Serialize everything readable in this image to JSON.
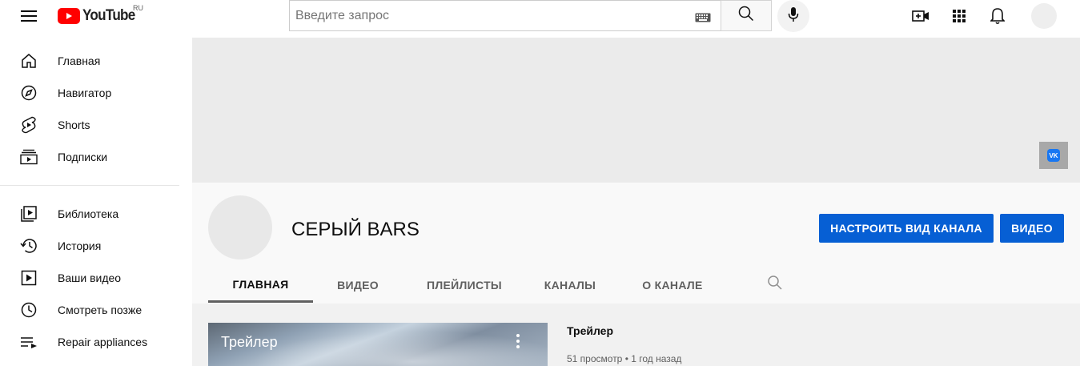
{
  "header": {
    "logo_text": "YouTube",
    "region": "RU",
    "search_placeholder": "Введите запрос"
  },
  "sidebar": {
    "items": [
      {
        "label": "Главная",
        "icon": "home-icon"
      },
      {
        "label": "Навигатор",
        "icon": "compass-icon"
      },
      {
        "label": "Shorts",
        "icon": "shorts-icon"
      },
      {
        "label": "Подписки",
        "icon": "subscriptions-icon"
      },
      {
        "label": "Библиотека",
        "icon": "library-icon"
      },
      {
        "label": "История",
        "icon": "history-icon"
      },
      {
        "label": "Ваши видео",
        "icon": "your-videos-icon"
      },
      {
        "label": "Смотреть позже",
        "icon": "watch-later-icon"
      },
      {
        "label": "Repair appliances",
        "icon": "playlist-icon"
      }
    ]
  },
  "channel": {
    "name": "СЕРЫЙ BARS",
    "customize_button": "НАСТРОИТЬ ВИД КАНАЛА",
    "video_button": "ВИДЕО",
    "vk_label": "VK"
  },
  "tabs": [
    {
      "label": "ГЛАВНАЯ",
      "active": true
    },
    {
      "label": "ВИДЕО",
      "active": false
    },
    {
      "label": "ПЛЕЙЛИСТЫ",
      "active": false
    },
    {
      "label": "КАНАЛЫ",
      "active": false
    },
    {
      "label": "О КАНАЛЕ",
      "active": false
    }
  ],
  "featured_video": {
    "thumb_title": "Трейлер",
    "title": "Трейлер",
    "meta": "51 просмотр • 1 год назад"
  },
  "colors": {
    "brand_red": "#ff0000",
    "accent_blue": "#065fd4"
  }
}
